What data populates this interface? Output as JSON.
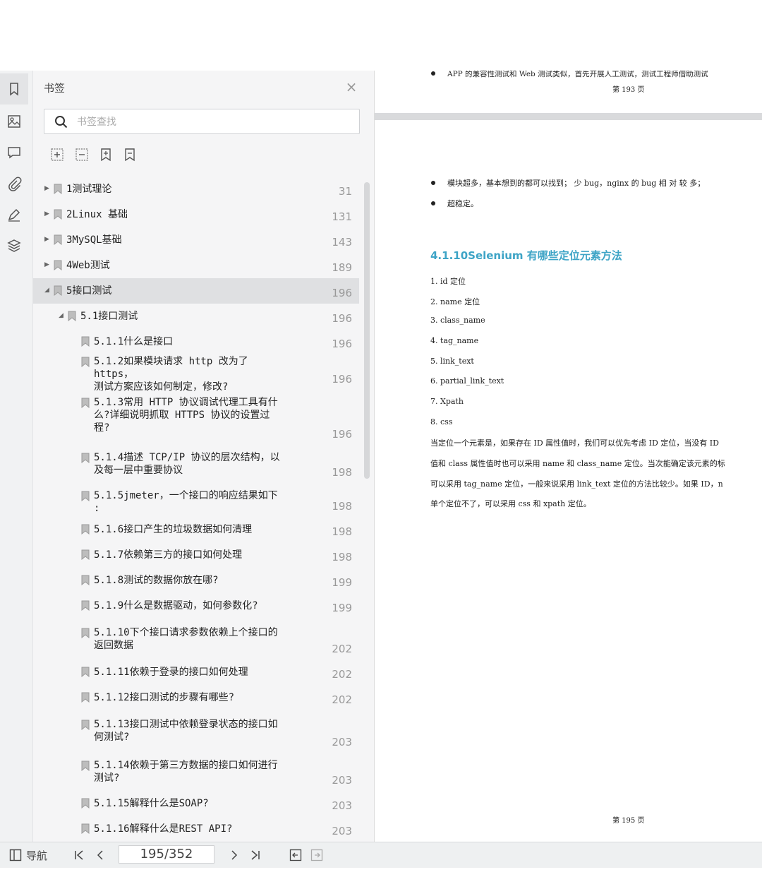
{
  "sidebar": {
    "title": "书签",
    "search_placeholder": "书签查找",
    "bookmarks": [
      {
        "label": "1测试理论",
        "page": "31"
      },
      {
        "label": "2Linux 基础",
        "page": "131"
      },
      {
        "label": "3MySQL基础",
        "page": "143"
      },
      {
        "label": "4Web测试",
        "page": "189"
      },
      {
        "label": "5接口测试",
        "page": "196"
      },
      {
        "label": "5.1接口测试",
        "page": "196"
      },
      {
        "label": "5.1.1什么是接口",
        "page": "196"
      },
      {
        "label": "5.1.2如果模块请求 http 改为了https，\n测试方案应该如何制定，修改?",
        "page": "196"
      },
      {
        "label": "5.1.3常用 HTTP 协议调试代理工具有什\n么?详细说明抓取 HTTPS 协议的设置过\n程?",
        "page": "196"
      },
      {
        "label": "5.1.4描述 TCP/IP 协议的层次结构，以\n及每一层中重要协议",
        "page": "198"
      },
      {
        "label": "5.1.5jmeter，一个接口的响应结果如下\n:",
        "page": "198"
      },
      {
        "label": "5.1.6接口产生的垃圾数据如何清理",
        "page": "198"
      },
      {
        "label": "5.1.7依赖第三方的接口如何处理",
        "page": "198"
      },
      {
        "label": "5.1.8测试的数据你放在哪?",
        "page": "199"
      },
      {
        "label": "5.1.9什么是数据驱动，如何参数化?",
        "page": "199"
      },
      {
        "label": "5.1.10下个接口请求参数依赖上个接口的\n返回数据",
        "page": "202"
      },
      {
        "label": "5.1.11依赖于登录的接口如何处理",
        "page": "202"
      },
      {
        "label": "5.1.12接口测试的步骤有哪些?",
        "page": "202"
      },
      {
        "label": "5.1.13接口测试中依赖登录状态的接口如\n何测试?",
        "page": "203"
      },
      {
        "label": "5.1.14依赖于第三方数据的接口如何进行\n测试?",
        "page": "203"
      },
      {
        "label": "5.1.15解释什么是SOAP?",
        "page": "203"
      },
      {
        "label": "5.1.16解释什么是REST API?",
        "page": "203"
      }
    ]
  },
  "document": {
    "prev_page_bullet": "APP 的兼容性测试和 Web 测试类似，首先开展人工测试，测试工程师借助测试",
    "prev_page_footer": "第 193 页",
    "bullets": [
      "模块超多，基本想到的都可以找到； 少 bug，nginx 的 bug 相 对 较 多；",
      "超稳定。"
    ],
    "heading": "4.1.10Selenium 有哪些定位元素方法",
    "list": [
      "1.  id 定位",
      "2.  name 定位",
      "3.  class_name",
      "4.  tag_name",
      "5.  link_text",
      "6.  partial_link_text",
      "7.  Xpath",
      "8.  css"
    ],
    "paragraph": [
      "当定位一个元素是，如果存在 ID 属性值时，我们可以优先考虑 ID 定位，当没有 ID",
      "值和 class 属性值时也可以采用 name 和 class_name 定位。当次能确定该元素的标",
      "可以采用 tag_name 定位，一般来说采用 link_text 定位的方法比较少。如果 ID，n",
      "单个定位不了，可以采用 css 和 xpath 定位。"
    ],
    "page_footer": "第 195 页"
  },
  "footer": {
    "nav_label": "导航",
    "page_indicator": "195/352"
  }
}
